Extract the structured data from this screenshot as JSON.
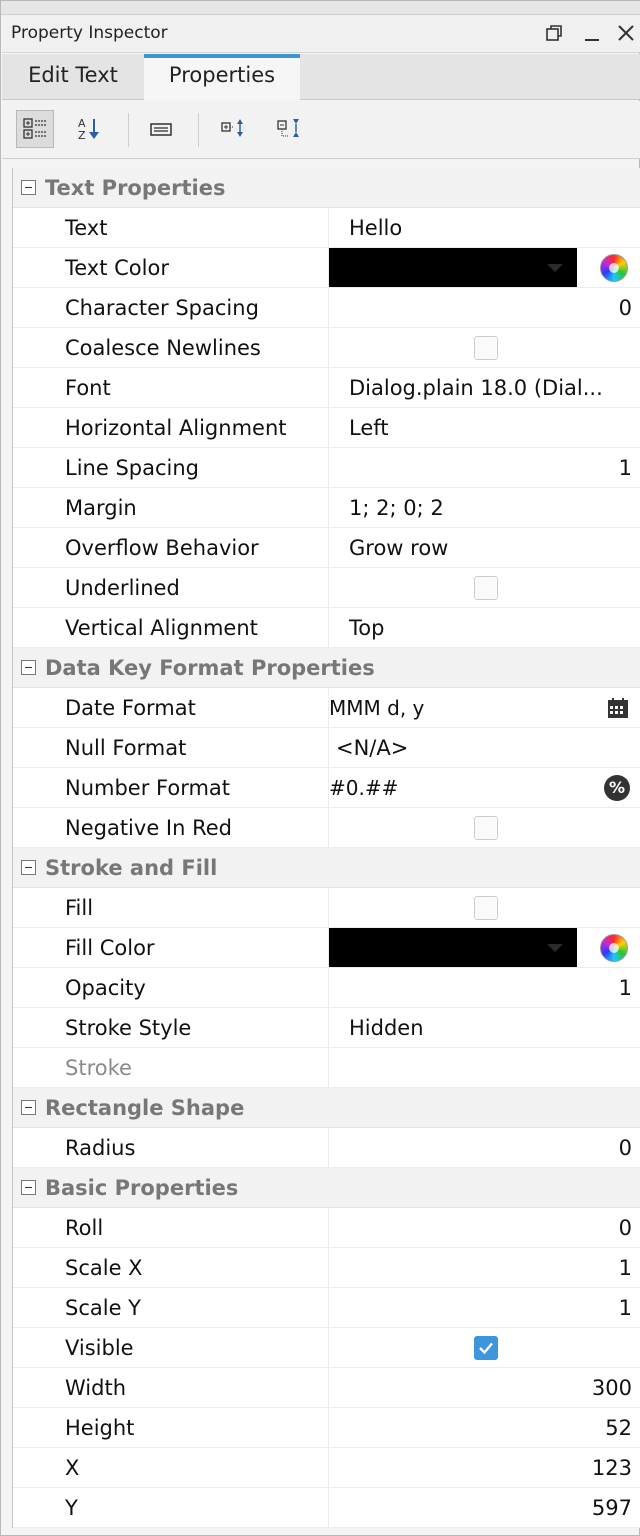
{
  "window": {
    "title": "Property Inspector",
    "icons": [
      "restore-icon",
      "minimize-icon",
      "close-icon"
    ]
  },
  "tabs": [
    {
      "label": "Edit Text",
      "active": false
    },
    {
      "label": "Properties",
      "active": true
    }
  ],
  "toolbar": {
    "buttons": [
      "categorized-view-icon",
      "sort-alphabetical-icon",
      "description-toggle-icon",
      "expand-all-icon",
      "collapse-all-icon"
    ],
    "pressed": "categorized-view-icon"
  },
  "groups": [
    {
      "name": "Text Properties",
      "rows": [
        {
          "name": "Text",
          "type": "text",
          "value": "Hello"
        },
        {
          "name": "Text Color",
          "type": "color",
          "value": "#000000"
        },
        {
          "name": "Character Spacing",
          "type": "number",
          "value": "0"
        },
        {
          "name": "Coalesce Newlines",
          "type": "checkbox",
          "checked": false
        },
        {
          "name": "Font",
          "type": "text",
          "value": "Dialog.plain 18.0 (Dial..."
        },
        {
          "name": "Horizontal Alignment",
          "type": "text",
          "value": "Left"
        },
        {
          "name": "Line Spacing",
          "type": "number",
          "value": "1"
        },
        {
          "name": "Margin",
          "type": "text",
          "value": "1; 2; 0; 2"
        },
        {
          "name": "Overflow Behavior",
          "type": "text",
          "value": "Grow row"
        },
        {
          "name": "Underlined",
          "type": "checkbox",
          "checked": false
        },
        {
          "name": "Vertical Alignment",
          "type": "text",
          "value": "Top"
        }
      ]
    },
    {
      "name": "Data Key Format Properties",
      "rows": [
        {
          "name": "Date Format",
          "type": "text-narrow",
          "value": "MMM d, y",
          "icon": "calendar-icon"
        },
        {
          "name": "Null Format",
          "type": "text-narrow2",
          "value": "<N/A>"
        },
        {
          "name": "Number Format",
          "type": "text-narrow",
          "value": "#0.##",
          "icon": "percent-icon"
        },
        {
          "name": "Negative In Red",
          "type": "checkbox",
          "checked": false
        }
      ]
    },
    {
      "name": "Stroke and Fill",
      "rows": [
        {
          "name": "Fill",
          "type": "checkbox",
          "checked": false
        },
        {
          "name": "Fill Color",
          "type": "color",
          "value": "#000000"
        },
        {
          "name": "Opacity",
          "type": "number",
          "value": "1"
        },
        {
          "name": "Stroke Style",
          "type": "text",
          "value": "Hidden"
        },
        {
          "name": "Stroke",
          "type": "disabled",
          "value": ""
        }
      ]
    },
    {
      "name": "Rectangle Shape",
      "rows": [
        {
          "name": "Radius",
          "type": "number",
          "value": "0"
        }
      ]
    },
    {
      "name": "Basic Properties",
      "rows": [
        {
          "name": "Roll",
          "type": "number",
          "value": "0"
        },
        {
          "name": "Scale X",
          "type": "number",
          "value": "1"
        },
        {
          "name": "Scale Y",
          "type": "number",
          "value": "1"
        },
        {
          "name": "Visible",
          "type": "checkbox",
          "checked": true
        },
        {
          "name": "Width",
          "type": "number",
          "value": "300"
        },
        {
          "name": "Height",
          "type": "number",
          "value": "52"
        },
        {
          "name": "X",
          "type": "number",
          "value": "123"
        },
        {
          "name": "Y",
          "type": "number",
          "value": "597"
        }
      ]
    }
  ]
}
